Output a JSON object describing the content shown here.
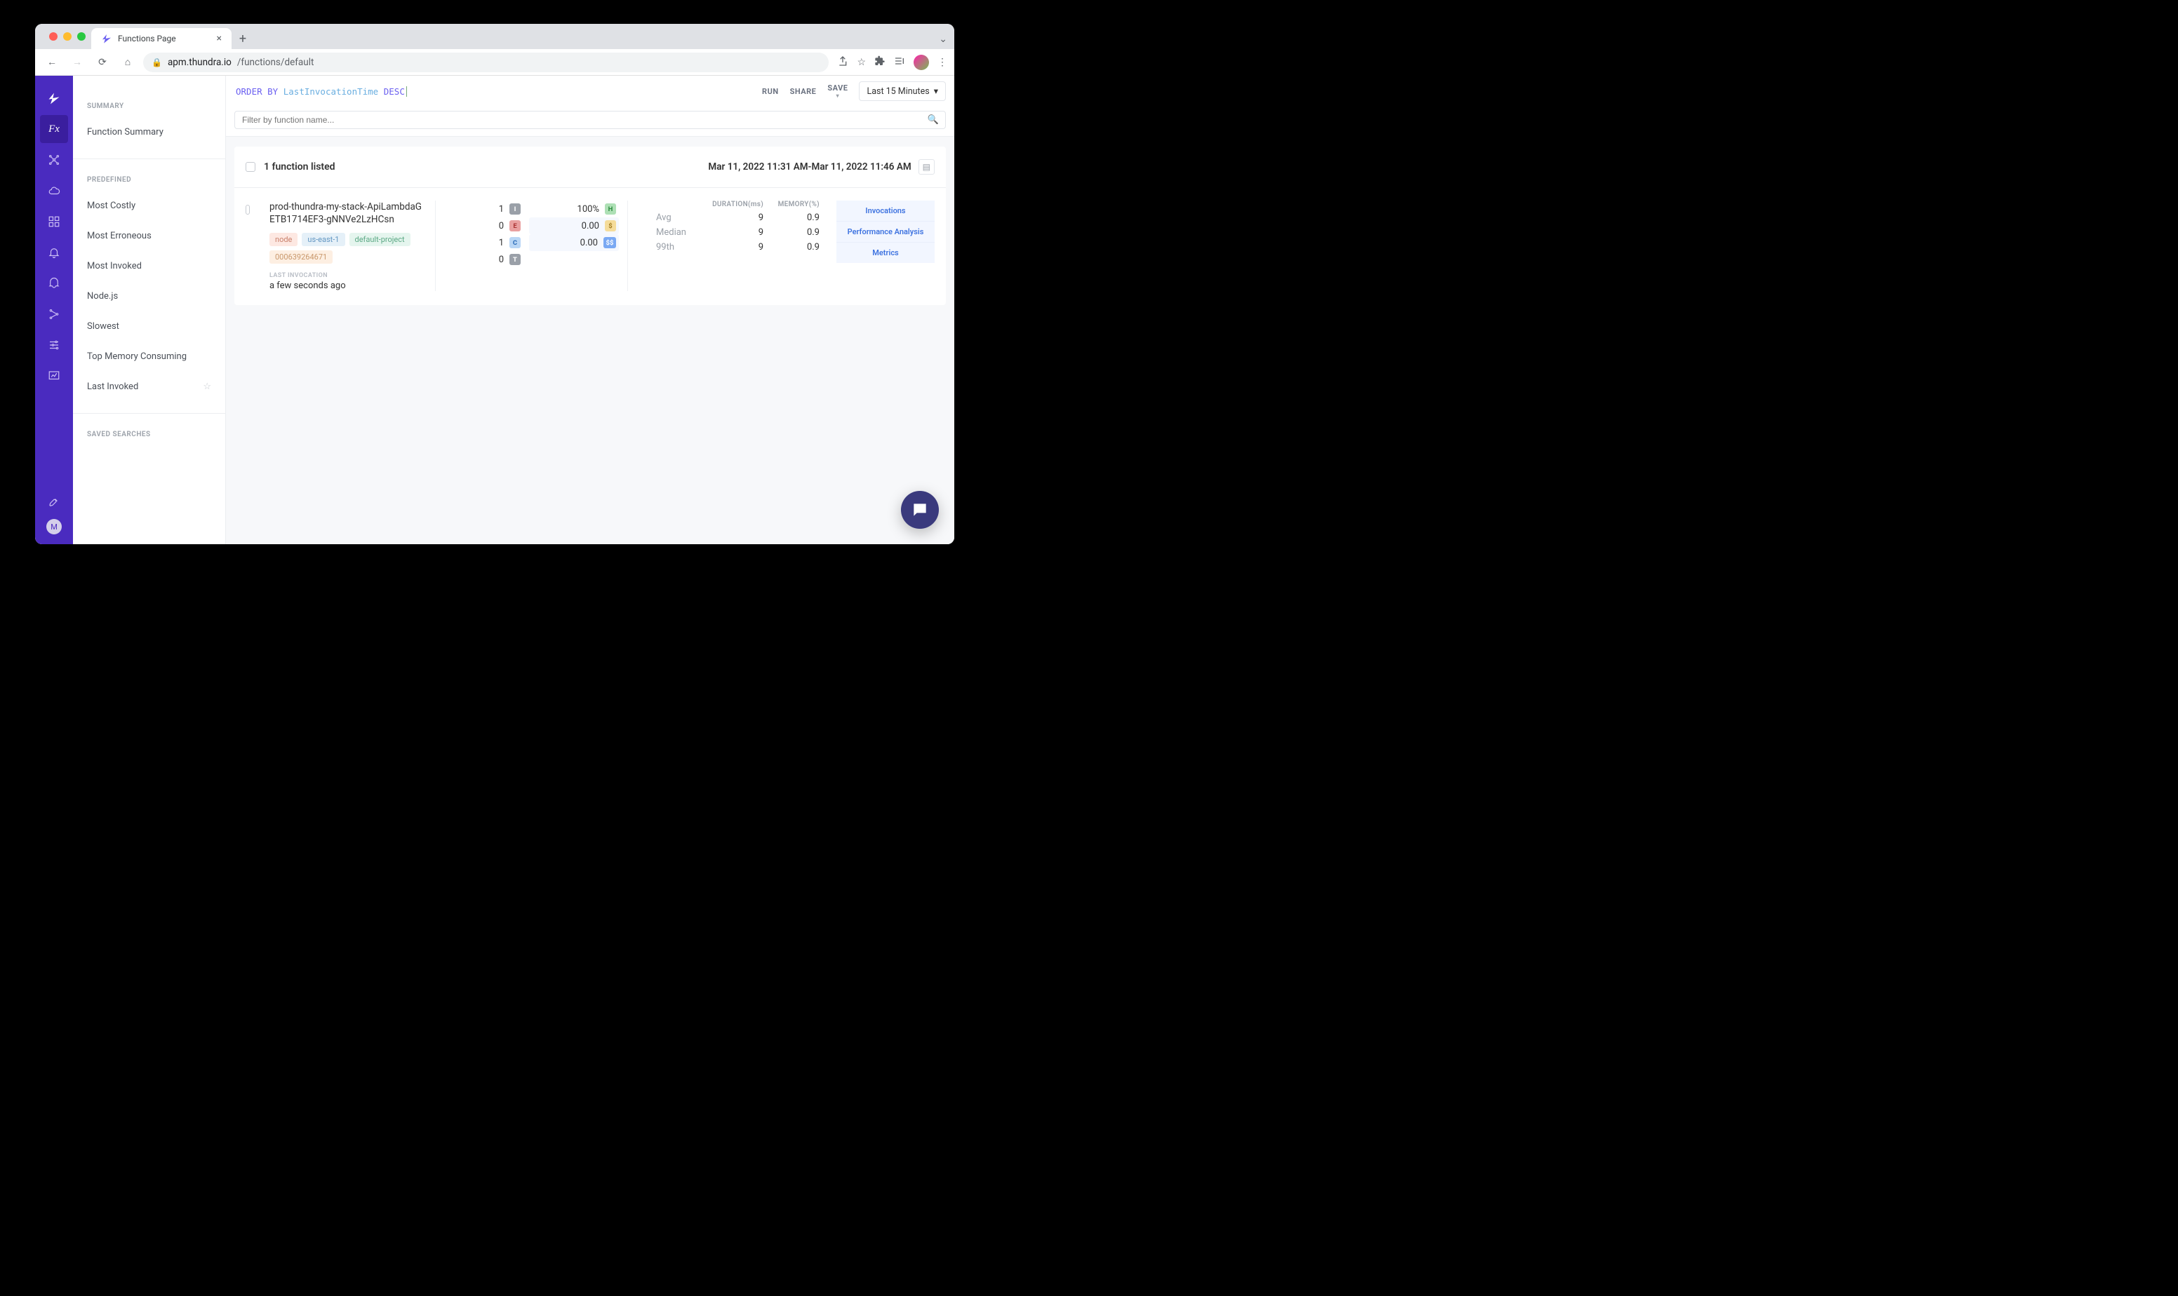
{
  "browser": {
    "tab_title": "Functions Page",
    "url_host": "apm.thundra.io",
    "url_path": "/functions/default"
  },
  "sidebar": {
    "summary_title": "SUMMARY",
    "summary_item": "Function Summary",
    "predefined_title": "PREDEFINED",
    "predefined_items": [
      "Most Costly",
      "Most Erroneous",
      "Most Invoked",
      "Node.js",
      "Slowest",
      "Top Memory Consuming",
      "Last Invoked"
    ],
    "saved_title": "SAVED SEARCHES"
  },
  "query": {
    "kw1": "ORDER BY",
    "ident": "LastInvocationTime",
    "kw2": "DESC",
    "run": "RUN",
    "share": "SHARE",
    "save": "SAVE",
    "time_range": "Last 15 Minutes",
    "filter_placeholder": "Filter by function name..."
  },
  "list": {
    "count_text": "1 function listed",
    "range_text": "Mar 11, 2022 11:31 AM-Mar 11, 2022 11:46 AM"
  },
  "fn": {
    "name": "prod-thundra-my-stack-ApiLambdaGETB1714EF3-gNNVe2LzHCsn",
    "tags": {
      "node": "node",
      "region": "us-east-1",
      "project": "default-project",
      "account": "000639264671"
    },
    "last_invocation_label": "LAST INVOCATION",
    "last_invocation_value": "a few seconds ago",
    "counts": {
      "I": "1",
      "E": "0",
      "C": "1",
      "T": "0"
    },
    "pcts": {
      "H": "100%",
      "S": "0.00",
      "SS": "0.00"
    },
    "stats": {
      "h_dur": "DURATION(ms)",
      "h_mem": "MEMORY(%)",
      "rows": [
        {
          "label": "Avg",
          "dur": "9",
          "mem": "0.9"
        },
        {
          "label": "Median",
          "dur": "9",
          "mem": "0.9"
        },
        {
          "label": "99th",
          "dur": "9",
          "mem": "0.9"
        }
      ]
    },
    "links": {
      "inv": "Invocations",
      "perf": "Performance Analysis",
      "metrics": "Metrics"
    }
  },
  "rail_avatar": "M"
}
